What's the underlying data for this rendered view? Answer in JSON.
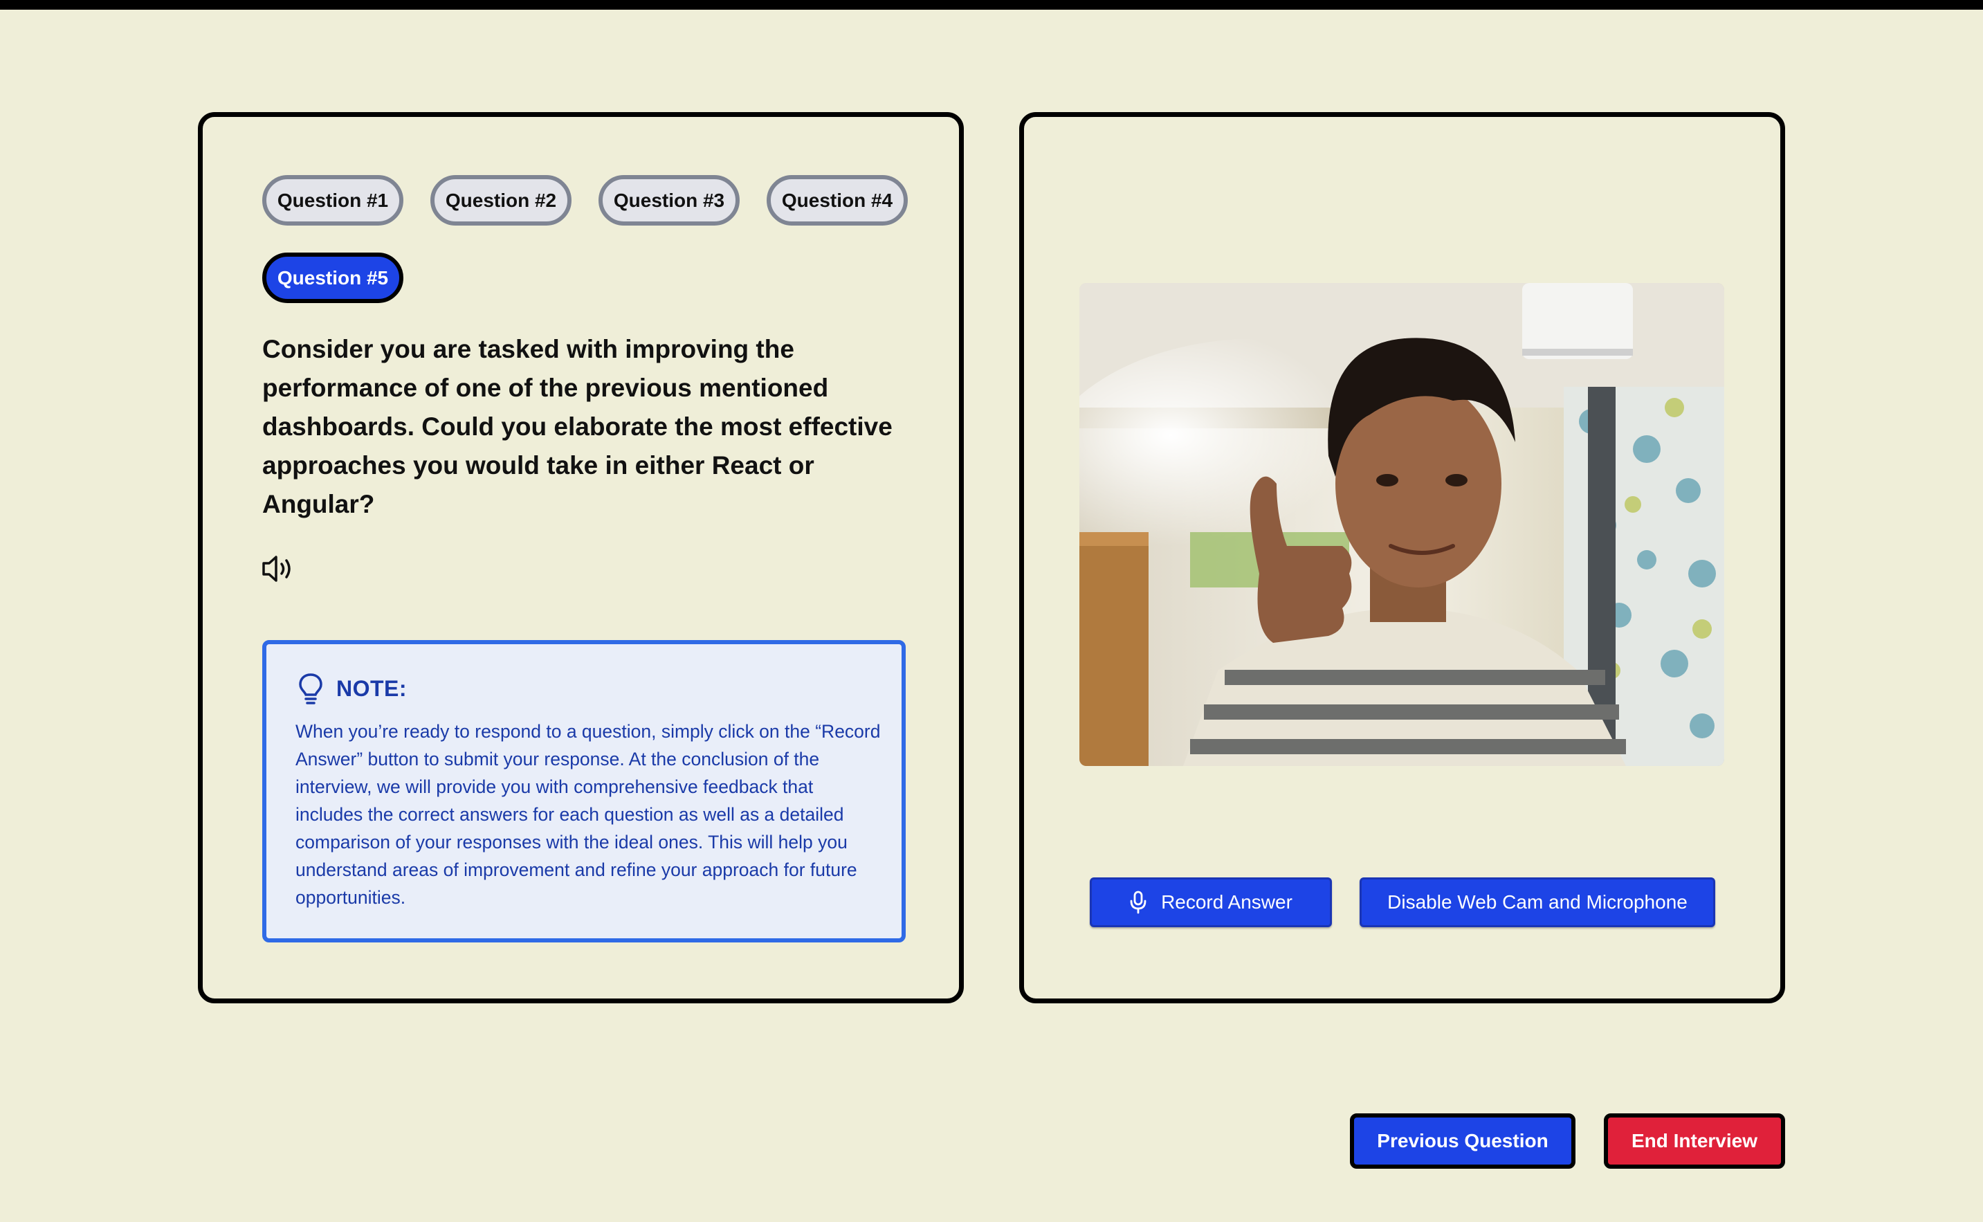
{
  "question_tabs": [
    {
      "label": "Question #1"
    },
    {
      "label": "Question #2"
    },
    {
      "label": "Question #3"
    },
    {
      "label": "Question #4"
    },
    {
      "label": "Question #5",
      "active": true
    }
  ],
  "question": {
    "text": "Consider you are tasked with improving the performance of one of the previous mentioned dashboards. Could you elaborate the most effective approaches you would take in either React or Angular?",
    "speaker_icon": "speaker-icon"
  },
  "note": {
    "icon": "lightbulb-icon",
    "title": "NOTE:",
    "body": "When you’re ready to respond to a question, simply click on the “Record Answer” button to submit your response. At the conclusion of the interview, we will provide you with comprehensive feedback that includes the correct answers for each question as well as a detailed comparison of your responses with the ideal ones. This will help you understand areas of improvement and refine your approach for future opportunities."
  },
  "webcam": {
    "buttons": {
      "record": "Record Answer",
      "disable": "Disable Web Cam and Microphone"
    }
  },
  "footer": {
    "previous": "Previous Question",
    "end": "End Interview"
  },
  "colors": {
    "background": "#efeed8",
    "primary": "#1d44e6",
    "danger": "#e0213a",
    "note_text": "#1a3aa8"
  }
}
